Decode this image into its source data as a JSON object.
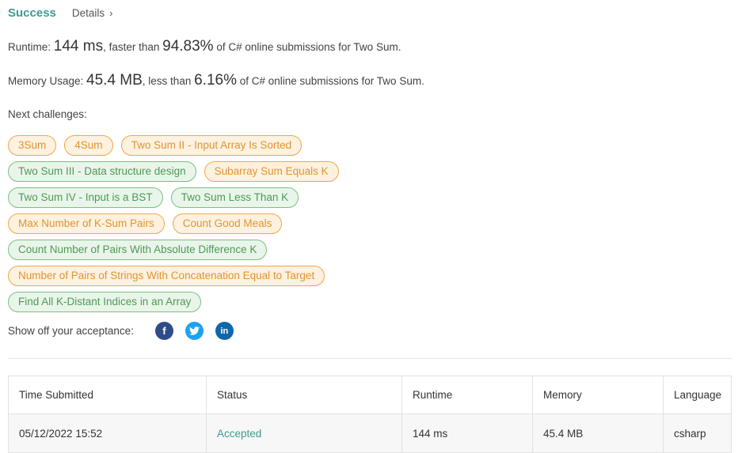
{
  "header": {
    "status": "Success",
    "details_label": "Details",
    "chevron": "›"
  },
  "runtime": {
    "label": "Runtime: ",
    "value": "144 ms",
    "middle": ", faster than ",
    "percent": "94.83%",
    "suffix": " of C# online submissions for Two Sum."
  },
  "memory": {
    "label": "Memory Usage: ",
    "value": "45.4 MB",
    "middle": ", less than ",
    "percent": "6.16%",
    "suffix": " of C# online submissions for Two Sum."
  },
  "next_challenges": {
    "label": "Next challenges:",
    "rows": [
      [
        {
          "label": "3Sum",
          "difficulty": "medium"
        },
        {
          "label": "4Sum",
          "difficulty": "medium"
        },
        {
          "label": "Two Sum II - Input Array Is Sorted",
          "difficulty": "medium"
        }
      ],
      [
        {
          "label": "Two Sum III - Data structure design",
          "difficulty": "easy"
        },
        {
          "label": "Subarray Sum Equals K",
          "difficulty": "medium"
        }
      ],
      [
        {
          "label": "Two Sum IV - Input is a BST",
          "difficulty": "easy"
        },
        {
          "label": "Two Sum Less Than K",
          "difficulty": "easy"
        }
      ],
      [
        {
          "label": "Max Number of K-Sum Pairs",
          "difficulty": "medium"
        },
        {
          "label": "Count Good Meals",
          "difficulty": "medium"
        }
      ],
      [
        {
          "label": "Count Number of Pairs With Absolute Difference K",
          "difficulty": "easy"
        }
      ],
      [
        {
          "label": "Number of Pairs of Strings With Concatenation Equal to Target",
          "difficulty": "medium"
        }
      ],
      [
        {
          "label": "Find All K-Distant Indices in an Array",
          "difficulty": "easy"
        }
      ]
    ]
  },
  "share": {
    "label": "Show off your acceptance:",
    "icons": [
      "facebook-icon",
      "twitter-icon",
      "linkedin-icon"
    ]
  },
  "table": {
    "headers": [
      "Time Submitted",
      "Status",
      "Runtime",
      "Memory",
      "Language"
    ],
    "rows": [
      [
        "05/12/2022 15:52",
        "Accepted",
        "144 ms",
        "45.4 MB",
        "csharp"
      ]
    ]
  },
  "colors": {
    "success": "#3e9b8e",
    "medium_border": "#f0a64a",
    "easy_border": "#7ac07f"
  }
}
